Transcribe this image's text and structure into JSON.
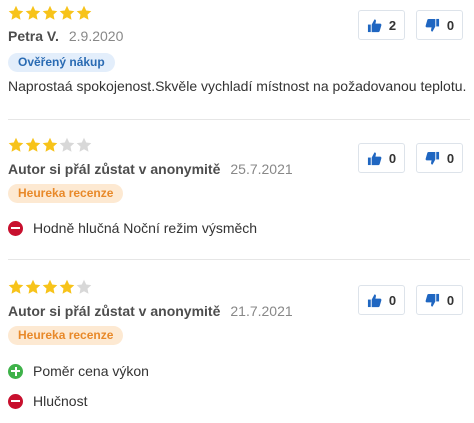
{
  "colors": {
    "star_filled": "#f7c31a",
    "star_empty": "#d8d8d8",
    "thumb_icon": "#1f66c1",
    "con_icon": "#c8102e",
    "pro_icon": "#3fb24a"
  },
  "reviews": [
    {
      "rating": 5,
      "author": "Petra V.",
      "date": "2.9.2020",
      "badge": "Ověřený nákup",
      "text": "Naprostaá spokojenost.Skvěle vychladí místnost na požadovanou teplotu.",
      "likes": "2",
      "dislikes": "0",
      "pros": [],
      "cons": []
    },
    {
      "rating": 3,
      "author": "Autor si přál zůstat v anonymitě",
      "date": "25.7.2021",
      "badge": "Heureka recenze",
      "likes": "0",
      "dislikes": "0",
      "pros": [],
      "cons": [
        "Hodně hlučná Noční režim výsměch"
      ]
    },
    {
      "rating": 4,
      "author": "Autor si přál zůstat v anonymitě",
      "date": "21.7.2021",
      "badge": "Heureka recenze",
      "likes": "0",
      "dislikes": "0",
      "pros": [
        "Poměr cena výkon"
      ],
      "cons": [
        "Hlučnost"
      ]
    }
  ]
}
